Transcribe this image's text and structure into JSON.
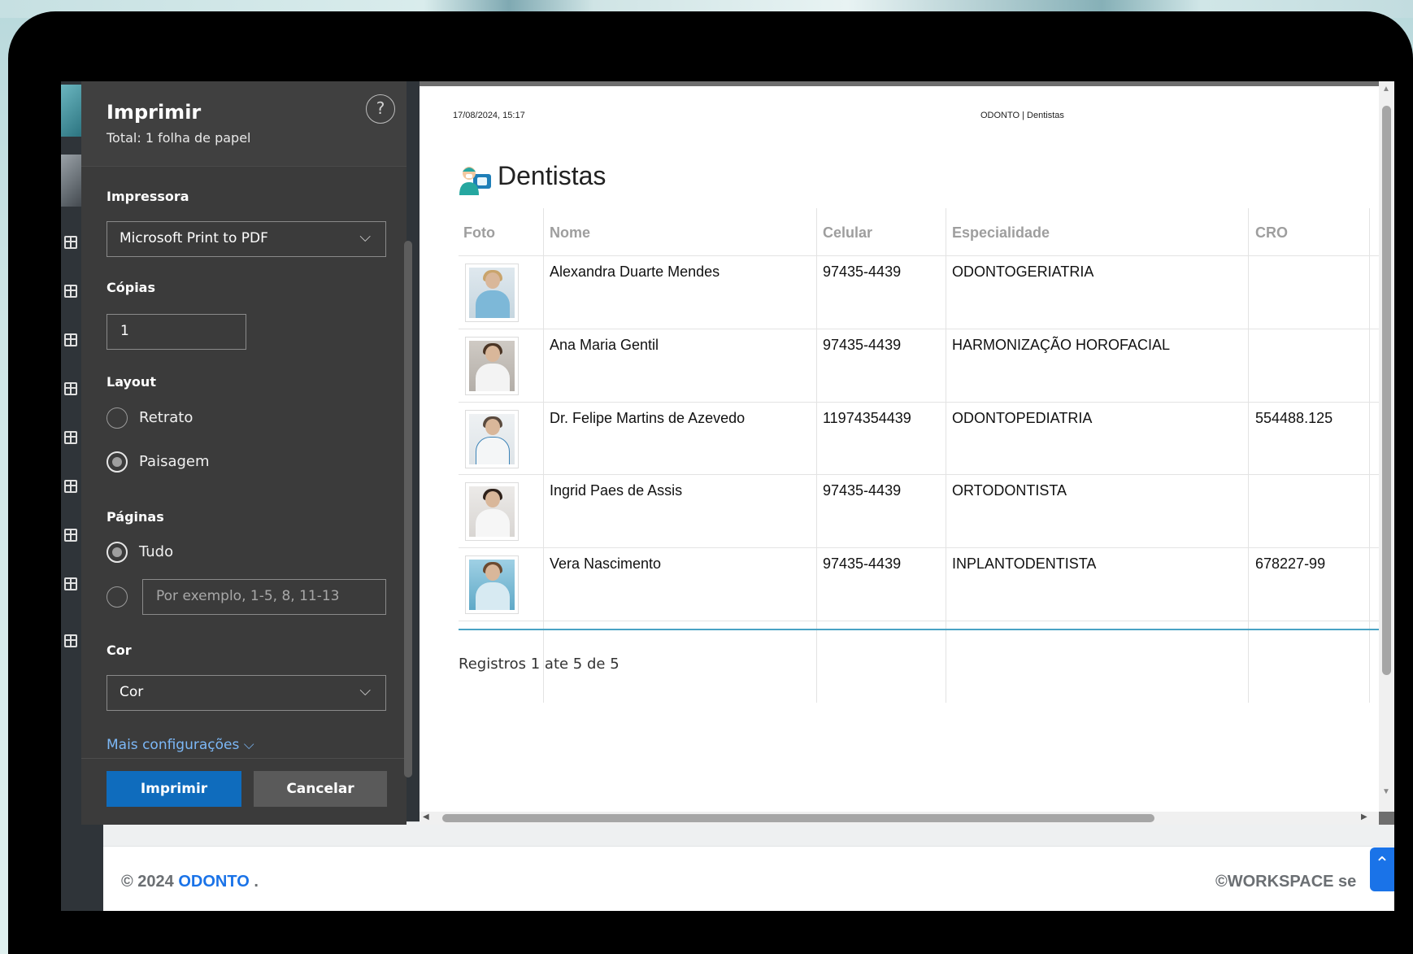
{
  "print_dialog": {
    "title": "Imprimir",
    "total": "Total: 1 folha de papel",
    "help": "?",
    "printer_label": "Impressora",
    "printer_value": "Microsoft Print to PDF",
    "copies_label": "Cópias",
    "copies_value": "1",
    "layout_label": "Layout",
    "layout_options": [
      "Retrato",
      "Paisagem"
    ],
    "layout_selected": "Paisagem",
    "pages_label": "Páginas",
    "pages_option_all": "Tudo",
    "pages_custom_placeholder": "Por exemplo, 1-5, 8, 11-13",
    "color_label": "Cor",
    "color_value": "Cor",
    "more_settings": "Mais configurações ⌵",
    "print_button": "Imprimir",
    "cancel_button": "Cancelar"
  },
  "preview": {
    "date": "17/08/2024, 15:17",
    "header_title": "ODONTO | Dentistas",
    "heading": "Dentistas",
    "columns": [
      "Foto",
      "Nome",
      "Celular",
      "Especialidade",
      "CRO"
    ],
    "rows": [
      {
        "nome": "Alexandra Duarte Mendes",
        "celular": "97435-4439",
        "especialidade": "ODONTOGERIATRIA",
        "cro": ""
      },
      {
        "nome": "Ana Maria Gentil",
        "celular": "97435-4439",
        "especialidade": "HARMONIZAÇÃO HOROFACIAL",
        "cro": ""
      },
      {
        "nome": "Dr. Felipe Martins de Azevedo",
        "celular": "11974354439",
        "especialidade": "ODONTOPEDIATRIA",
        "cro": "554488.125"
      },
      {
        "nome": "Ingrid Paes de Assis",
        "celular": "97435-4439",
        "especialidade": "ORTODONTISTA",
        "cro": ""
      },
      {
        "nome": "Vera Nascimento",
        "celular": "97435-4439",
        "especialidade": "INPLANTODENTISTA",
        "cro": "678227-99"
      }
    ],
    "records": "Registros 1 ate 5 de 5"
  },
  "footer": {
    "copyright_prefix": "© 2024 ",
    "brand": "ODONTO",
    "copyright_suffix": " .",
    "right_text": "©WORKSPACE se"
  },
  "colors": {
    "accent": "#0f6cbd",
    "brand_link": "#1a73e8",
    "table_rule": "#4aa3c4"
  }
}
